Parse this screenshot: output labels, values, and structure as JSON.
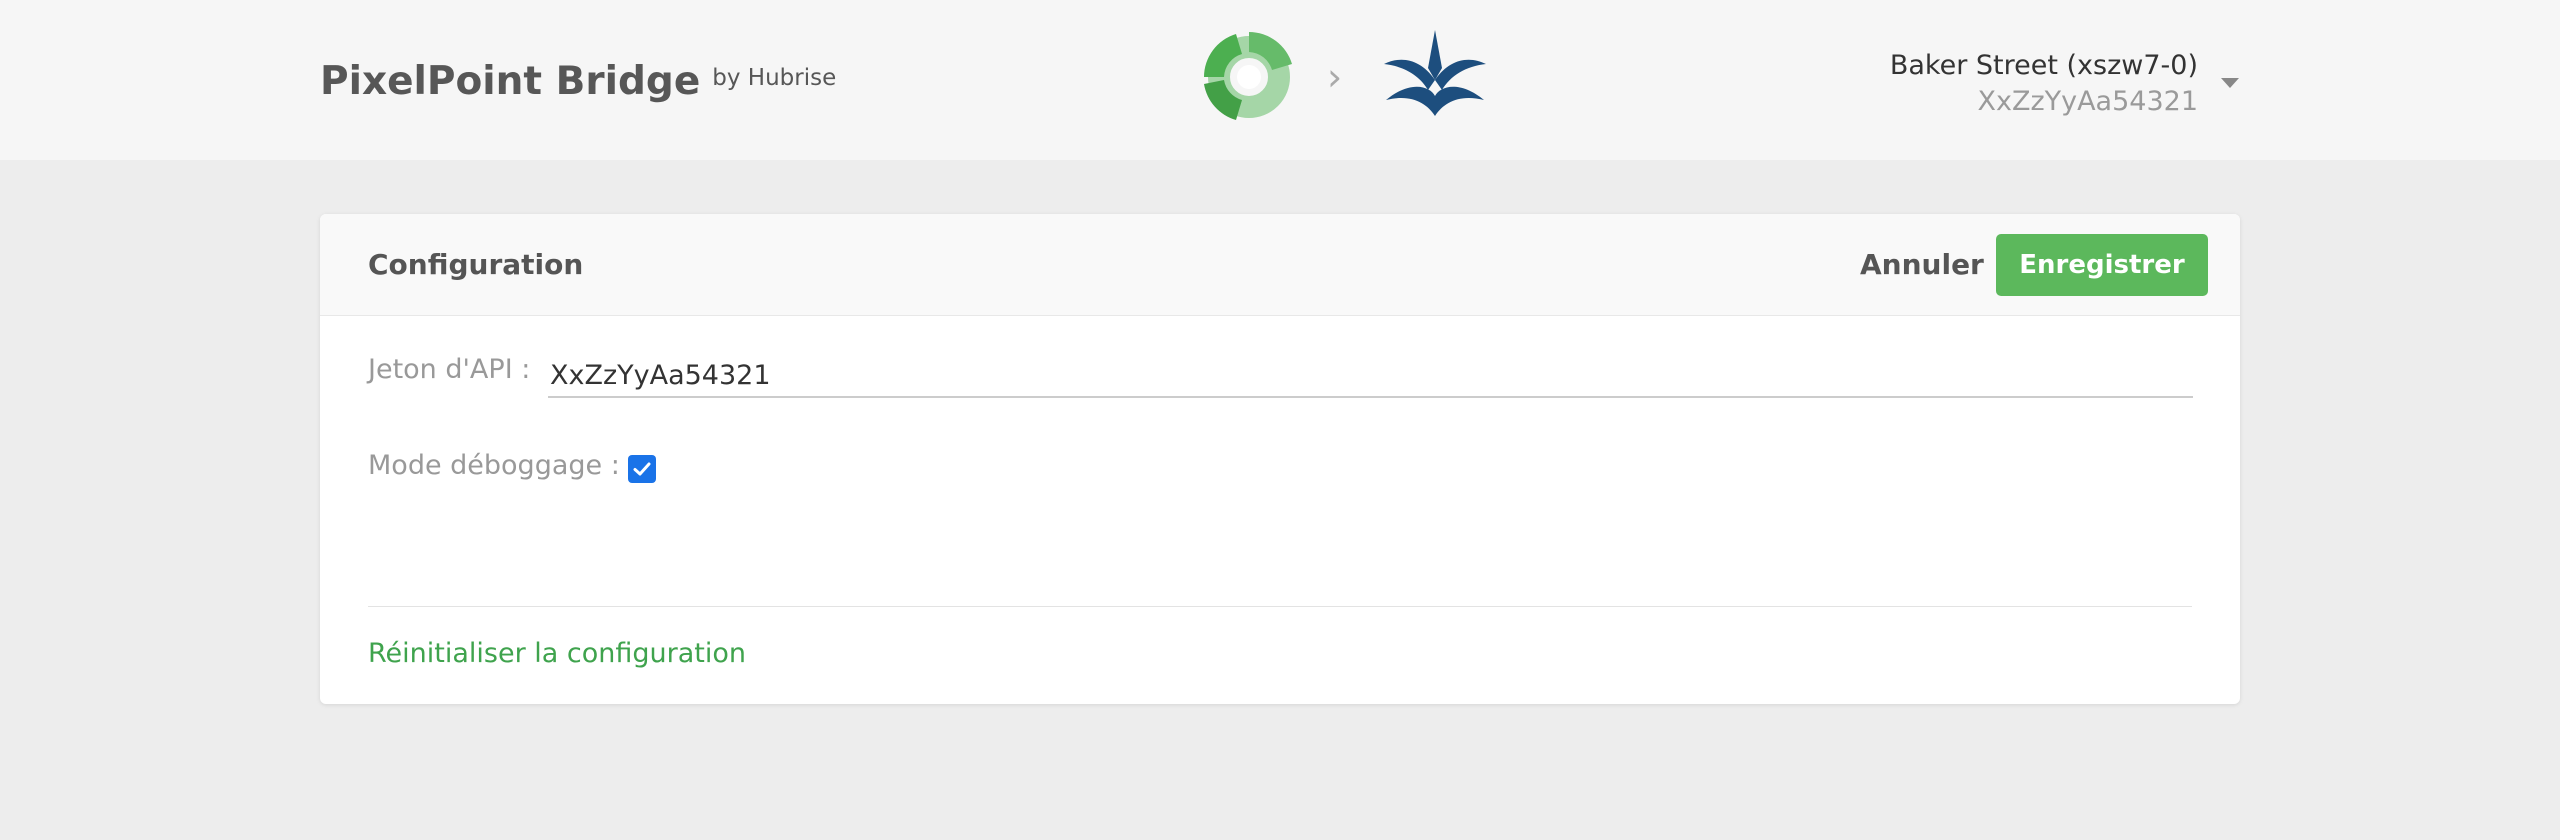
{
  "header": {
    "brand_title": "PixelPoint Bridge",
    "brand_by": "by Hubrise",
    "location_name": "Baker Street (xszw7-0)",
    "location_id": "XxZzYyAa54321",
    "connector_chevron": "›"
  },
  "config": {
    "title": "Configuration",
    "cancel_label": "Annuler",
    "save_label": "Enregistrer",
    "api_token_label": "Jeton d'API :",
    "api_token_value": "XxZzYyAa54321",
    "debug_label": "Mode déboggage :",
    "debug_checked": true,
    "reset_label": "Réinitialiser la configuration"
  },
  "colors": {
    "accent_green": "#5cb85c",
    "link_green": "#3fa34d",
    "checkbox_blue": "#1a73e8",
    "pixelpoint_blue": "#1d4e7e"
  },
  "icons": {
    "hubrise_logo": "hubrise-logo",
    "pixelpoint_logo": "pixelpoint-logo",
    "dropdown": "caret-down-icon",
    "check": "check-icon"
  }
}
